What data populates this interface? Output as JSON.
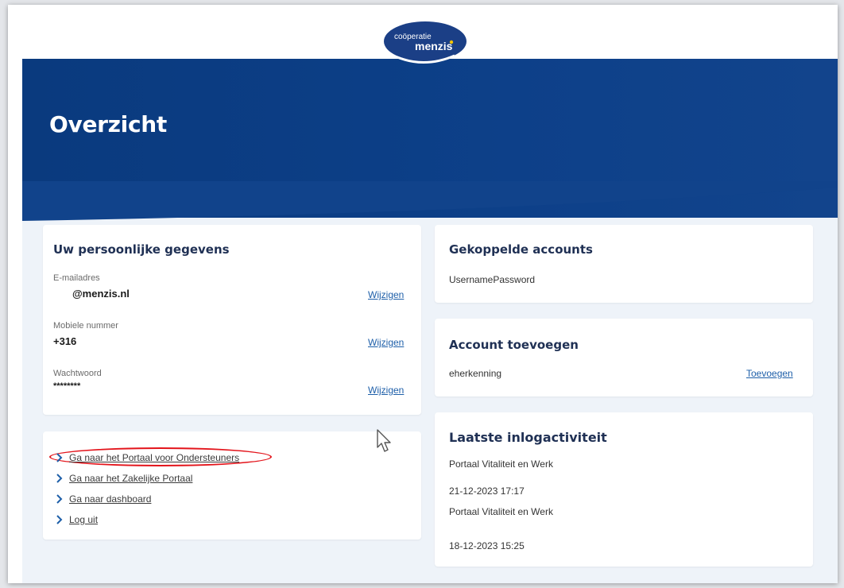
{
  "logo": {
    "line1": "coöperatie",
    "line2": "menzis"
  },
  "header": {
    "title": "Overzicht"
  },
  "personal": {
    "title": "Uw persoonlijke gegevens",
    "fields": [
      {
        "label": "E-mailadres",
        "value": "@menzis.nl",
        "action": "Wijzigen"
      },
      {
        "label": "Mobiele nummer",
        "value": "+316",
        "action": "Wijzigen"
      },
      {
        "label": "Wachtwoord",
        "value": "********",
        "action": "Wijzigen"
      }
    ]
  },
  "links": {
    "items": [
      {
        "label": "Ga naar het Portaal voor Ondersteuners"
      },
      {
        "label": "Ga naar het Zakelijke Portaal"
      },
      {
        "label": "Ga naar dashboard"
      },
      {
        "label": "Log uit"
      }
    ],
    "highlight_color": "#e3141b"
  },
  "linked_accounts": {
    "title": "Gekoppelde accounts",
    "items": [
      "UsernamePassword"
    ]
  },
  "add_account": {
    "title": "Account toevoegen",
    "provider": "eherkenning",
    "action": "Toevoegen"
  },
  "login_activity": {
    "title": "Laatste inlogactiviteit",
    "entries": [
      "Portaal Vitaliteit en Werk",
      "21-12-2023 17:17",
      "Portaal Vitaliteit en Werk",
      "18-12-2023 15:25"
    ]
  },
  "colors": {
    "brand_blue": "#0d4089",
    "page_background": "#eef3f9",
    "link_blue": "#1e5fa9",
    "logo_yellow": "#f5c400"
  }
}
